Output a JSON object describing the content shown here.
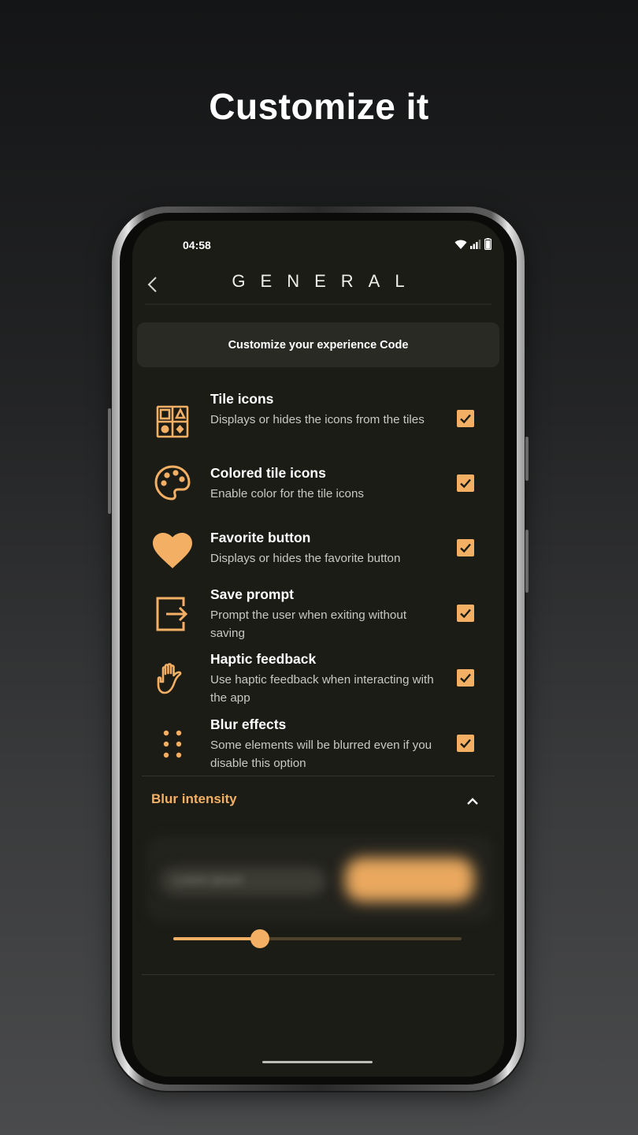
{
  "headline": "Customize it",
  "status_bar": {
    "time": "04:58",
    "icons": [
      "wifi-icon",
      "cell-signal-icon",
      "battery-icon"
    ]
  },
  "app_bar": {
    "back_icon": "chevron-left-icon",
    "title": "GENERAL"
  },
  "banner": {
    "text": "Customize your experience Code"
  },
  "settings": [
    {
      "icon": "tile-grid-icon",
      "title": "Tile icons",
      "description": "Displays or hides the icons from the tiles",
      "checked": true
    },
    {
      "icon": "palette-icon",
      "title": "Colored tile icons",
      "description": "Enable color for the tile icons",
      "checked": true
    },
    {
      "icon": "heart-icon",
      "title": "Favorite button",
      "description": "Displays or hides the favorite button",
      "checked": true
    },
    {
      "icon": "exit-icon",
      "title": "Save prompt",
      "description": "Prompt the user when exiting without saving",
      "checked": true
    },
    {
      "icon": "hand-icon",
      "title": "Haptic feedback",
      "description": "Use haptic feedback when interacting with the app",
      "checked": true
    },
    {
      "icon": "dots-icon",
      "title": "Blur effects",
      "description": "Some elements will be blurred even if you disable this option",
      "checked": true
    }
  ],
  "blur_section": {
    "label": "Blur intensity",
    "expanded": true,
    "chevron_icon": "chevron-up-icon",
    "preview_left_text": "Lorem ipsum",
    "slider_value": 0.3
  },
  "colors": {
    "accent": "#f3b064",
    "screen_bg": "#1c1c17",
    "banner_bg": "#2a2a24",
    "text_primary": "#ffffff",
    "text_secondary": "#c9c9c2"
  }
}
